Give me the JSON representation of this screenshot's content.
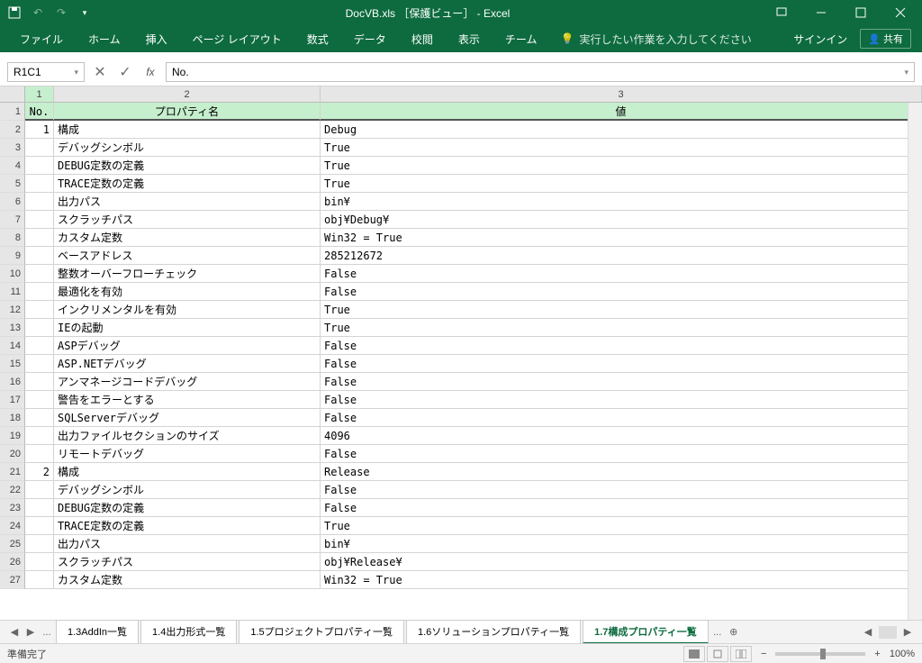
{
  "titlebar": {
    "title": "DocVB.xls ［保護ビュー］ - Excel"
  },
  "ribbon": {
    "tabs": [
      "ファイル",
      "ホーム",
      "挿入",
      "ページ レイアウト",
      "数式",
      "データ",
      "校閲",
      "表示",
      "チーム"
    ],
    "tell_me": "実行したい作業を入力してください",
    "signin": "サインイン",
    "share": "共有"
  },
  "formula_bar": {
    "name_box": "R1C1",
    "fx": "fx",
    "value": "No."
  },
  "columns": [
    "1",
    "2",
    "3"
  ],
  "headers": {
    "c1": "No.",
    "c2": "プロパティ名",
    "c3": "値"
  },
  "rows": [
    {
      "rn": "2",
      "no": "1",
      "prop": "構成",
      "val": "Debug"
    },
    {
      "rn": "3",
      "no": "",
      "prop": "デバッグシンボル",
      "val": "True"
    },
    {
      "rn": "4",
      "no": "",
      "prop": "DEBUG定数の定義",
      "val": "True"
    },
    {
      "rn": "5",
      "no": "",
      "prop": "TRACE定数の定義",
      "val": "True"
    },
    {
      "rn": "6",
      "no": "",
      "prop": "出力パス",
      "val": "bin¥"
    },
    {
      "rn": "7",
      "no": "",
      "prop": "スクラッチパス",
      "val": "obj¥Debug¥"
    },
    {
      "rn": "8",
      "no": "",
      "prop": "カスタム定数",
      "val": "Win32 = True"
    },
    {
      "rn": "9",
      "no": "",
      "prop": "ベースアドレス",
      "val": "285212672"
    },
    {
      "rn": "10",
      "no": "",
      "prop": "整数オーバーフローチェック",
      "val": "False"
    },
    {
      "rn": "11",
      "no": "",
      "prop": "最適化を有効",
      "val": "False"
    },
    {
      "rn": "12",
      "no": "",
      "prop": "インクリメンタルを有効",
      "val": "True"
    },
    {
      "rn": "13",
      "no": "",
      "prop": "IEの起動",
      "val": "True"
    },
    {
      "rn": "14",
      "no": "",
      "prop": "ASPデバッグ",
      "val": "False"
    },
    {
      "rn": "15",
      "no": "",
      "prop": "ASP.NETデバッグ",
      "val": "False"
    },
    {
      "rn": "16",
      "no": "",
      "prop": "アンマネージコードデバッグ",
      "val": "False"
    },
    {
      "rn": "17",
      "no": "",
      "prop": "警告をエラーとする",
      "val": "False"
    },
    {
      "rn": "18",
      "no": "",
      "prop": "SQLServerデバッグ",
      "val": "False"
    },
    {
      "rn": "19",
      "no": "",
      "prop": "出力ファイルセクションのサイズ",
      "val": "4096"
    },
    {
      "rn": "20",
      "no": "",
      "prop": "リモートデバッグ",
      "val": "False"
    },
    {
      "rn": "21",
      "no": "2",
      "prop": "構成",
      "val": "Release"
    },
    {
      "rn": "22",
      "no": "",
      "prop": "デバッグシンボル",
      "val": "False"
    },
    {
      "rn": "23",
      "no": "",
      "prop": "DEBUG定数の定義",
      "val": "False"
    },
    {
      "rn": "24",
      "no": "",
      "prop": "TRACE定数の定義",
      "val": "True"
    },
    {
      "rn": "25",
      "no": "",
      "prop": "出力パス",
      "val": "bin¥"
    },
    {
      "rn": "26",
      "no": "",
      "prop": "スクラッチパス",
      "val": "obj¥Release¥"
    },
    {
      "rn": "27",
      "no": "",
      "prop": "カスタム定数",
      "val": "Win32 = True"
    }
  ],
  "sheet_tabs": {
    "ellipsis": "...",
    "tabs": [
      "1.3AddIn一覧",
      "1.4出力形式一覧",
      "1.5プロジェクトプロパティ一覧",
      "1.6ソリューションプロパティ一覧",
      "1.7構成プロパティ一覧"
    ],
    "active_index": 4
  },
  "statusbar": {
    "status": "準備完了",
    "zoom": "100%"
  }
}
